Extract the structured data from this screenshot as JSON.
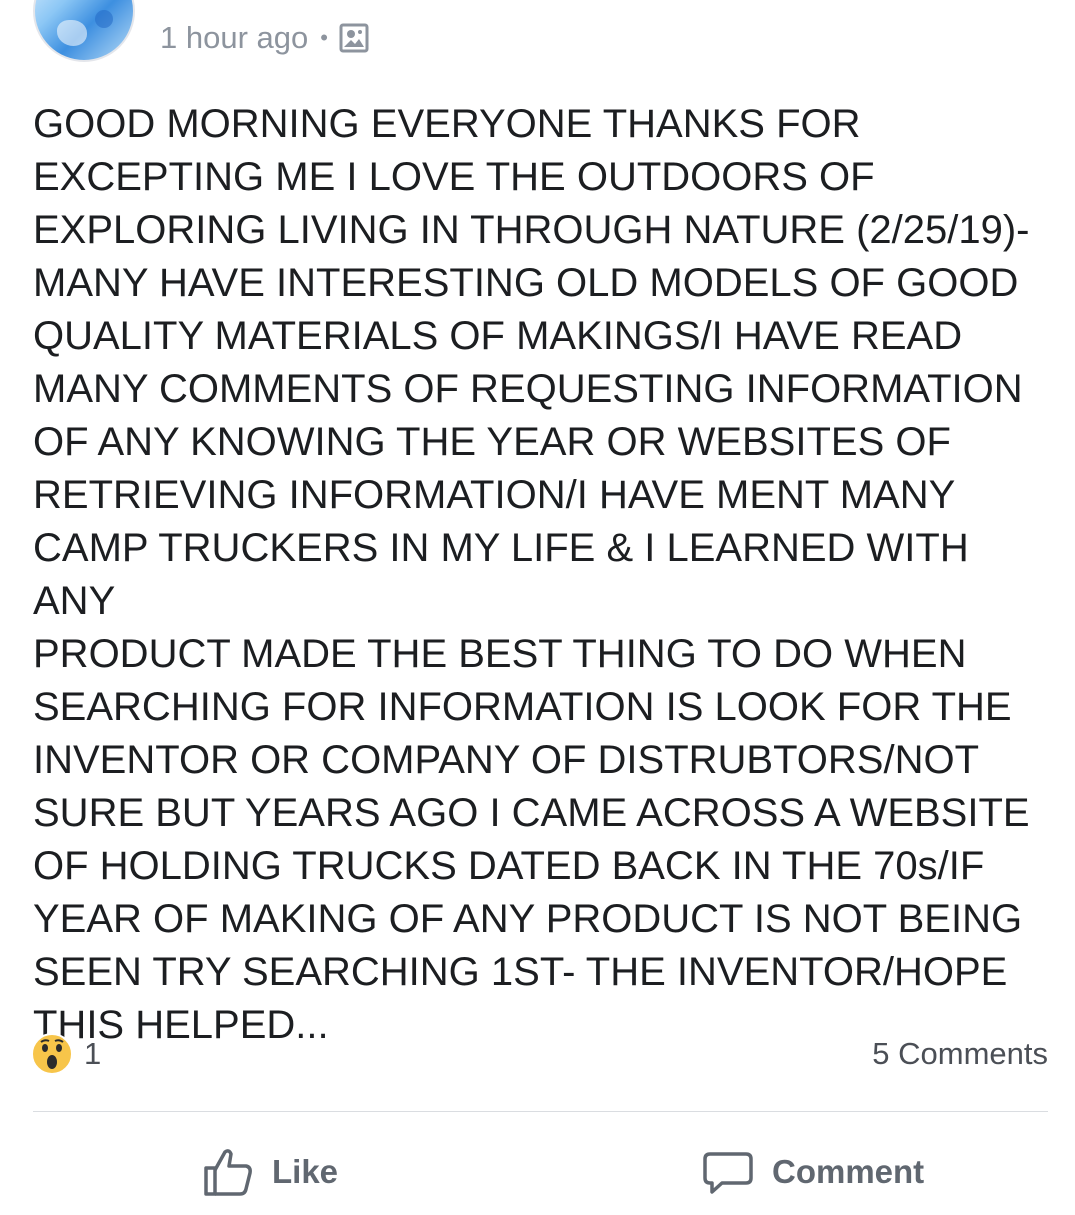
{
  "post": {
    "timestamp": "1 hour ago",
    "separator": "•",
    "audience_icon": "photo-album-icon",
    "text": "GOOD MORNING EVERYONE THANKS FOR\nEXCEPTING ME I LOVE THE OUTDOORS OF\nEXPLORING LIVING IN THROUGH NATURE (2/25/19)-\nMANY HAVE INTERESTING OLD MODELS OF GOOD\nQUALITY MATERIALS OF MAKINGS/I HAVE READ\nMANY COMMENTS OF REQUESTING INFORMATION\nOF ANY KNOWING THE YEAR OR WEBSITES OF\nRETRIEVING INFORMATION/I HAVE MENT MANY\nCAMP TRUCKERS IN MY LIFE & I LEARNED WITH ANY\nPRODUCT MADE THE BEST THING TO DO WHEN\nSEARCHING FOR INFORMATION IS LOOK FOR THE\nINVENTOR OR COMPANY OF DISTRUBTORS/NOT\nSURE BUT YEARS AGO I CAME ACROSS A WEBSITE\nOF HOLDING TRUCKS DATED BACK IN THE 70s/IF\nYEAR OF MAKING OF ANY PRODUCT IS NOT BEING\nSEEN TRY SEARCHING 1ST- THE INVENTOR/HOPE\nTHIS HELPED..."
  },
  "stats": {
    "reaction_icon": "wow-reaction-icon",
    "reaction_count": "1",
    "comments": "5 Comments"
  },
  "actions": {
    "like_label": "Like",
    "comment_label": "Comment"
  },
  "colors": {
    "meta_gray": "#8d949e",
    "action_gray": "#606770",
    "wow_yellow": "#f7c54a",
    "divider": "#dadde1"
  }
}
